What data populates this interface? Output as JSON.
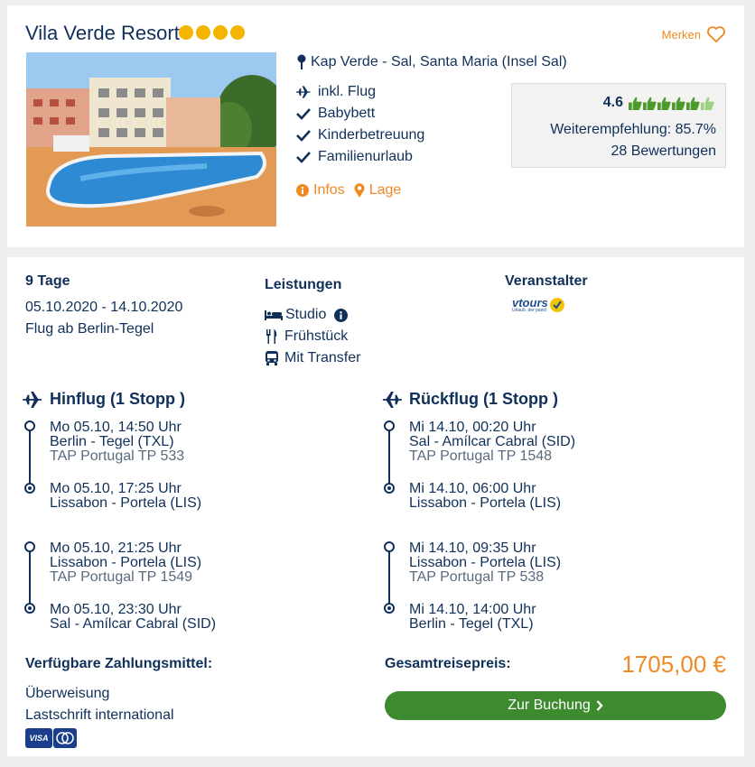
{
  "hotel": {
    "name": "Vila Verde Resort",
    "stars": 4,
    "merken_label": "Merken",
    "location": "Kap Verde - Sal, Santa Maria (Insel Sal)",
    "features": [
      "inkl. Flug",
      "Babybett",
      "Kinderbetreuung",
      "Familienurlaub"
    ],
    "infos_label": "Infos",
    "lage_label": "Lage",
    "rating": {
      "score": "4.6",
      "thumbs_total": 6,
      "thumbs_filled": 5,
      "recommendation": "Weiterempfehlung: 85.7%",
      "reviews": "28 Bewertungen"
    }
  },
  "trip": {
    "duration": "9 Tage",
    "dates": "05.10.2020 - 14.10.2020",
    "departure": "Flug ab Berlin-Tegel"
  },
  "services": {
    "heading": "Leistungen",
    "items": [
      "Studio",
      "Frühstück",
      "Mit Transfer"
    ]
  },
  "operator": {
    "heading": "Veranstalter",
    "logo_text": "vtours",
    "logo_tagline": "Urlaub, der passt"
  },
  "outbound": {
    "heading": "Hinflug (1 Stopp )",
    "legs": [
      {
        "dep_time": "Mo 05.10, 14:50 Uhr",
        "dep_airport": "Berlin - Tegel (TXL)",
        "airline": "TAP Portugal TP 533",
        "arr_time": "Mo 05.10, 17:25 Uhr",
        "arr_airport": "Lissabon - Portela (LIS)"
      },
      {
        "dep_time": "Mo 05.10, 21:25 Uhr",
        "dep_airport": "Lissabon - Portela (LIS)",
        "airline": "TAP Portugal TP 1549",
        "arr_time": "Mo 05.10, 23:30 Uhr",
        "arr_airport": "Sal - Amílcar Cabral (SID)"
      }
    ]
  },
  "return": {
    "heading": "Rückflug (1 Stopp )",
    "legs": [
      {
        "dep_time": "Mi 14.10, 00:20 Uhr",
        "dep_airport": "Sal - Amílcar Cabral (SID)",
        "airline": "TAP Portugal TP 1548",
        "arr_time": "Mi 14.10, 06:00 Uhr",
        "arr_airport": "Lissabon - Portela (LIS)"
      },
      {
        "dep_time": "Mi 14.10, 09:35 Uhr",
        "dep_airport": "Lissabon - Portela (LIS)",
        "airline": "TAP Portugal TP 538",
        "arr_time": "Mi 14.10, 14:00 Uhr",
        "arr_airport": "Berlin - Tegel (TXL)"
      }
    ]
  },
  "payment": {
    "heading": "Verfügbare Zahlungsmittel:",
    "methods": [
      "Überweisung",
      "Lastschrift international"
    ],
    "visa_label": "VISA"
  },
  "price": {
    "label": "Gesamtreisepreis:",
    "value": "1705,00 €"
  },
  "booking": {
    "button_label": "Zur Buchung"
  },
  "colors": {
    "navy": "#10305a",
    "orange": "#f08a24",
    "green": "#3e8a2e",
    "thumb_green": "#4c9a2a",
    "star": "#f4b400"
  }
}
